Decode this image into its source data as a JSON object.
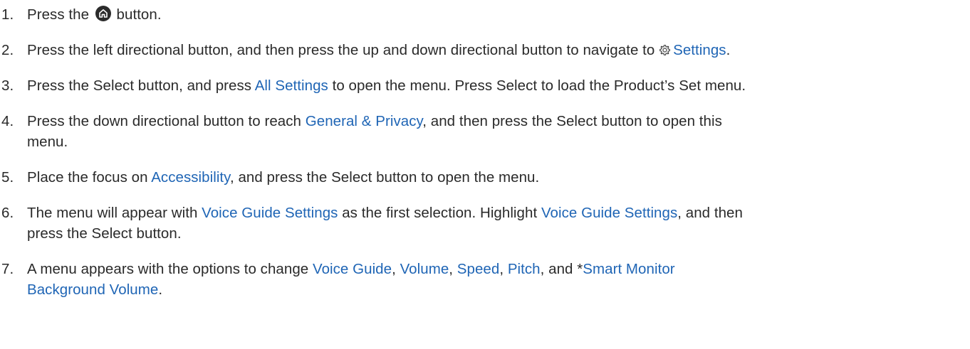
{
  "steps": [
    {
      "number": "1.",
      "parts": {
        "a": "Press the ",
        "b": " button."
      }
    },
    {
      "number": "2.",
      "parts": {
        "a": "Press the left directional button, and then press the up and down directional button to navigate to ",
        "link1": "Settings",
        "b": "."
      }
    },
    {
      "number": "3.",
      "parts": {
        "a": "Press the Select button, and press ",
        "link1": "All Settings",
        "b": " to open the menu. Press Select to load the Product’s Set menu."
      }
    },
    {
      "number": "4.",
      "parts": {
        "a": "Press the down directional button to reach ",
        "link1": "General & Privacy",
        "b": ", and then press the Select button to open this",
        "c": "menu."
      }
    },
    {
      "number": "5.",
      "parts": {
        "a": "Place the focus on ",
        "link1": "Accessibility",
        "b": ", and press the Select button to open the menu."
      }
    },
    {
      "number": "6.",
      "parts": {
        "a": "The menu will appear with ",
        "link1": "Voice Guide Settings",
        "b": " as the first selection. Highlight ",
        "link2": "Voice Guide Settings",
        "c": ", and then",
        "d": "press the Select button."
      }
    },
    {
      "number": "7.",
      "parts": {
        "a": "A menu appears with the options to change ",
        "link1": "Voice Guide",
        "sep1": ", ",
        "link2": "Volume",
        "sep2": ", ",
        "link3": "Speed",
        "sep3": ", ",
        "link4": "Pitch",
        "sep4": ", and *",
        "link5": "Smart Monitor",
        "link5b": "Background Volume",
        "end": "."
      }
    }
  ],
  "colors": {
    "text": "#2a2a2a",
    "link": "#1f65b5"
  },
  "icons": {
    "home": "home-icon",
    "settings": "gear-icon"
  }
}
